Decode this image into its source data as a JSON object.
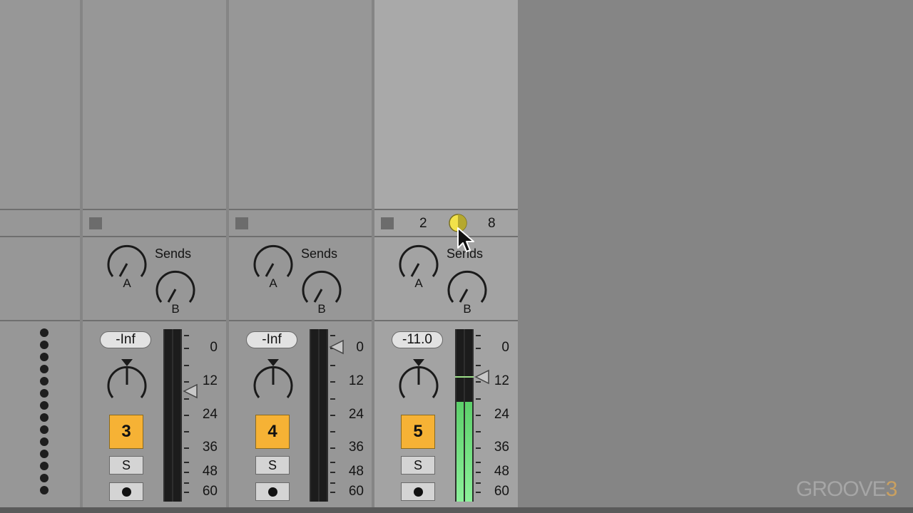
{
  "sends_label": "Sends",
  "knob_labels": {
    "a": "A",
    "b": "B"
  },
  "meter_scale": [
    "0",
    "12",
    "24",
    "36",
    "48",
    "60"
  ],
  "colors": {
    "track_button": "#f6b235",
    "meter_green": "#7be58a",
    "xover_knob": "#f2e24a"
  },
  "tracks": [
    {
      "volume": "-Inf",
      "number": "3",
      "solo": "S",
      "meter_level": 0
    },
    {
      "volume": "-Inf",
      "number": "4",
      "solo": "S",
      "meter_level": 0
    },
    {
      "volume": "-11.0",
      "number": "5",
      "solo": "S",
      "meter_level": 0.58
    }
  ],
  "crossfade": {
    "left": "2",
    "right": "8"
  },
  "watermark": {
    "main": "GROOVE",
    "accent": "3"
  }
}
